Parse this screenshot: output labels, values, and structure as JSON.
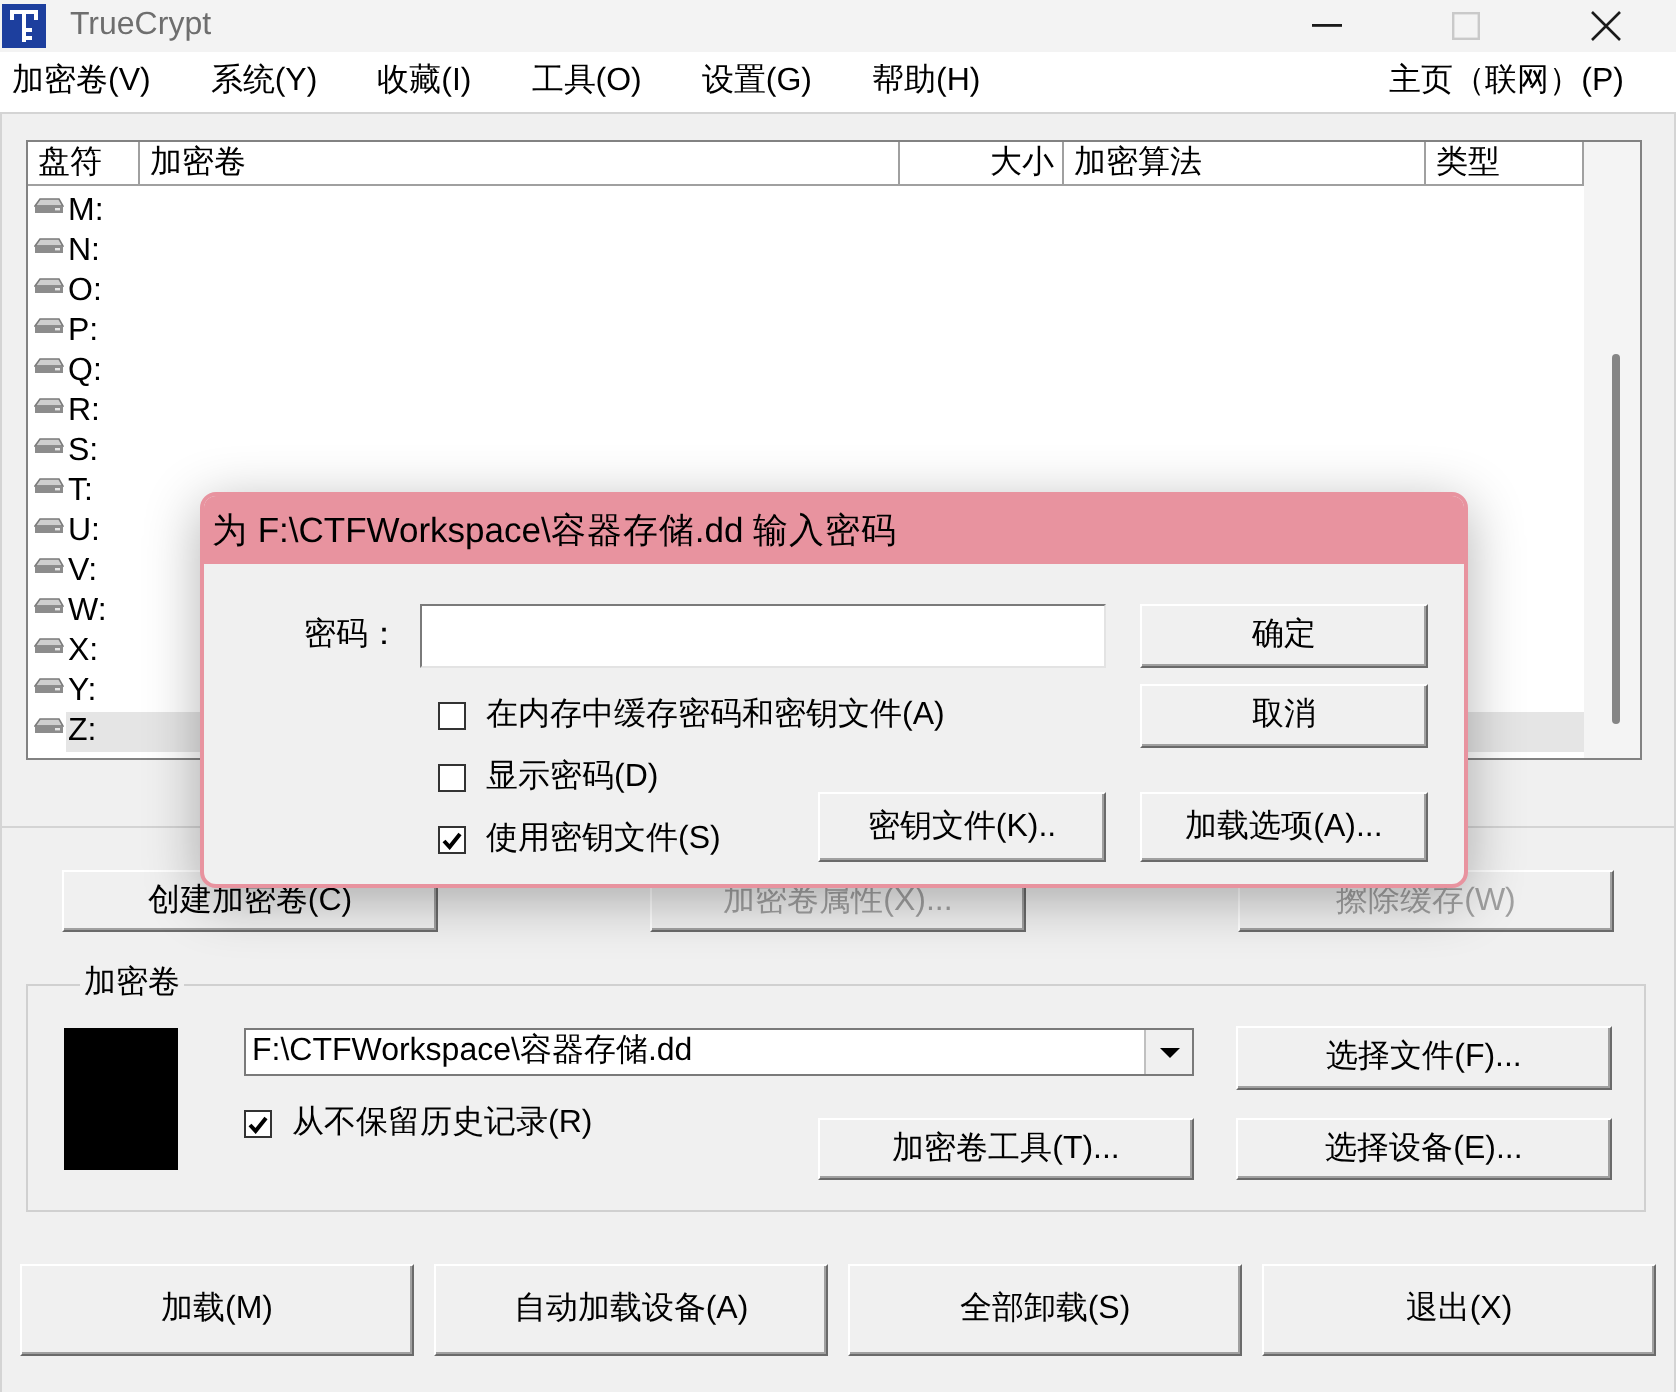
{
  "window": {
    "title": "TrueCrypt",
    "buttons": [
      {
        "kind": "minimize",
        "disabled": false
      },
      {
        "kind": "maximize",
        "disabled": true
      },
      {
        "kind": "close",
        "disabled": false
      }
    ]
  },
  "menu": {
    "items": [
      "加密卷(V)",
      "系统(Y)",
      "收藏(I)",
      "工具(O)",
      "设置(G)",
      "帮助(H)"
    ],
    "right_item": "主页（联网）(P)"
  },
  "drive_list": {
    "columns": [
      "盘符",
      "加密卷",
      "大小",
      "加密算法",
      "类型"
    ],
    "rows": [
      {
        "drive": "M:",
        "selected": false
      },
      {
        "drive": "N:",
        "selected": false
      },
      {
        "drive": "O:",
        "selected": false
      },
      {
        "drive": "P:",
        "selected": false
      },
      {
        "drive": "Q:",
        "selected": false
      },
      {
        "drive": "R:",
        "selected": false
      },
      {
        "drive": "S:",
        "selected": false
      },
      {
        "drive": "T:",
        "selected": false
      },
      {
        "drive": "U:",
        "selected": false
      },
      {
        "drive": "V:",
        "selected": false
      },
      {
        "drive": "W:",
        "selected": false
      },
      {
        "drive": "X:",
        "selected": false
      },
      {
        "drive": "Y:",
        "selected": false
      },
      {
        "drive": "Z:",
        "selected": true
      }
    ]
  },
  "actions": [
    {
      "label": "创建加密卷(C)",
      "disabled": false
    },
    {
      "label": "加密卷属性(X)...",
      "disabled": true
    },
    {
      "label": "擦除缓存(W)",
      "disabled": true
    }
  ],
  "volume_group": {
    "title": "加密卷",
    "path": "F:\\CTFWorkspace\\容器存储.dd",
    "never_save_history": {
      "label": "从不保留历史记录(R)",
      "checked": true
    },
    "select_file_button": "选择文件(F)...",
    "volume_tools_button": "加密卷工具(T)...",
    "select_device_button": "选择设备(E)..."
  },
  "bottom_buttons": [
    "加载(M)",
    "自动加载设备(A)",
    "全部卸载(S)",
    "退出(X)"
  ],
  "password_dialog": {
    "title": "为 F:\\CTFWorkspace\\容器存储.dd 输入密码",
    "password_label": "密码：",
    "options": [
      {
        "label": "在内存中缓存密码和密钥文件(A)",
        "checked": false
      },
      {
        "label": "显示密码(D)",
        "checked": false
      },
      {
        "label": "使用密钥文件(S)",
        "checked": true
      }
    ],
    "ok_button": "确定",
    "cancel_button": "取消",
    "keyfiles_button": "密钥文件(K)..",
    "mount_options_button": "加载选项(A)..."
  }
}
